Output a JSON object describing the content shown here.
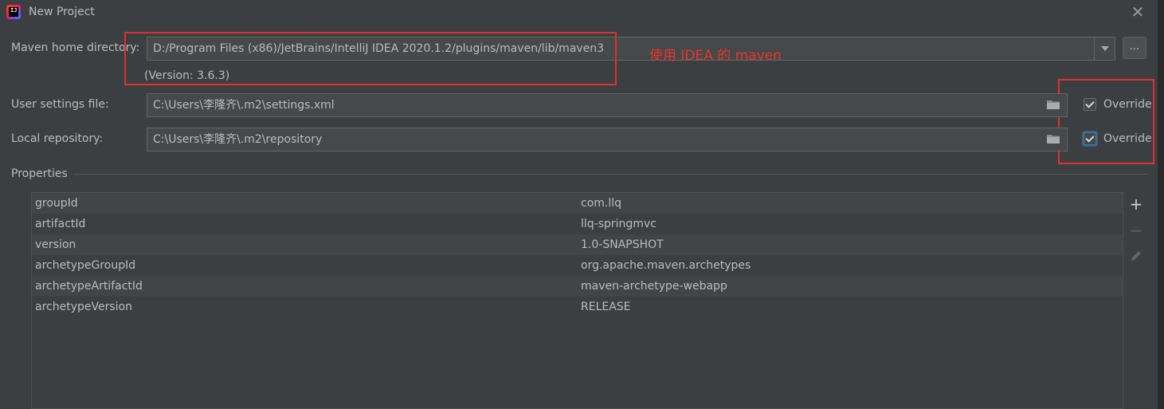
{
  "window": {
    "title": "New Project",
    "close_label": "✕"
  },
  "maven_home": {
    "label": "Maven home directory:",
    "value": "D:/Program Files (x86)/JetBrains/IntelliJ IDEA 2020.1.2/plugins/maven/lib/maven3",
    "version": "(Version: 3.6.3)",
    "browse_label": "..."
  },
  "annotation": {
    "text": "使用 IDEA 的 maven",
    "color": "#e8352d"
  },
  "user_settings": {
    "label": "User settings file:",
    "value": "C:\\Users\\李隆齐\\.m2\\settings.xml",
    "override_label": "Override",
    "override_checked": true
  },
  "local_repository": {
    "label": "Local repository:",
    "value": "C:\\Users\\李隆齐\\.m2\\repository",
    "override_label": "Override",
    "override_checked": true
  },
  "properties": {
    "title": "Properties",
    "rows": [
      {
        "key": "groupId",
        "value": "com.llq"
      },
      {
        "key": "artifactId",
        "value": "llq-springmvc"
      },
      {
        "key": "version",
        "value": "1.0-SNAPSHOT"
      },
      {
        "key": "archetypeGroupId",
        "value": "org.apache.maven.archetypes"
      },
      {
        "key": "archetypeArtifactId",
        "value": "maven-archetype-webapp"
      },
      {
        "key": "archetypeVersion",
        "value": "RELEASE"
      }
    ],
    "toolbar": {
      "add_icon": "+",
      "remove_icon": "−",
      "edit_icon": "pencil-icon"
    }
  }
}
